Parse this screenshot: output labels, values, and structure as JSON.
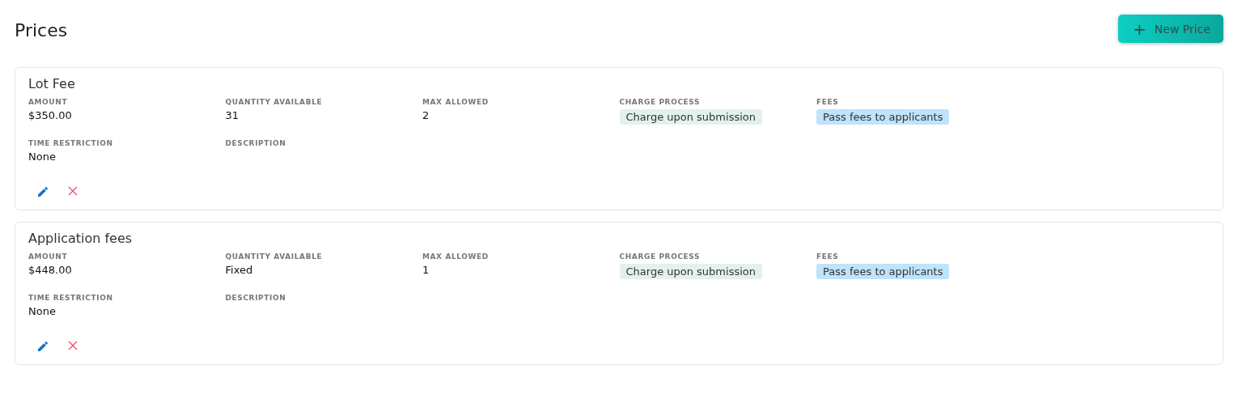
{
  "header": {
    "title": "Prices",
    "new_button": {
      "icon": "+",
      "label": "New Price"
    }
  },
  "prices": [
    {
      "name": "Lot Fee",
      "fields": [
        {
          "kind": "text",
          "label": "AMOUNT",
          "value": "$350.00"
        },
        {
          "kind": "text",
          "label": "QUANTITY AVAILABLE",
          "value": "31"
        },
        {
          "kind": "text",
          "label": "MAX ALLOWED",
          "value": "2"
        },
        {
          "kind": "tag",
          "label": "CHARGE PROCESS",
          "value": "Charge upon submission",
          "color": "#e3f1ec"
        },
        {
          "kind": "tag",
          "label": "FEES",
          "value": "Pass fees to applicants",
          "color": "#bfe3fb"
        },
        {
          "kind": "text",
          "label": "TIME RESTRICTION",
          "value": "None"
        },
        {
          "kind": "text",
          "label": "DESCRIPTION"
        }
      ]
    },
    {
      "name": "Application fees",
      "fields": [
        {
          "kind": "text",
          "label": "AMOUNT",
          "value": "$448.00"
        },
        {
          "kind": "text",
          "label": "QUANTITY AVAILABLE",
          "value": "Fixed"
        },
        {
          "kind": "text",
          "label": "MAX ALLOWED",
          "value": "1"
        },
        {
          "kind": "tag",
          "label": "CHARGE PROCESS",
          "value": "Charge upon submission",
          "color": "#e3f1ec"
        },
        {
          "kind": "tag",
          "label": "FEES",
          "value": "Pass fees to applicants",
          "color": "#bfe3fb"
        },
        {
          "kind": "text",
          "label": "TIME RESTRICTION",
          "value": "None"
        },
        {
          "kind": "text",
          "label": "DESCRIPTION"
        }
      ]
    }
  ]
}
